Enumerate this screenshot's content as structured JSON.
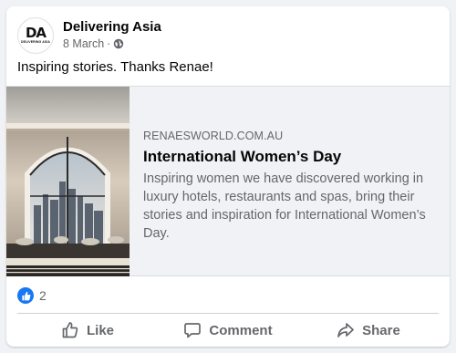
{
  "post": {
    "page_name": "Delivering Asia",
    "date": "8 March",
    "separator": "·",
    "privacy_icon": "globe-icon",
    "text": "Inspiring stories. Thanks Renae!",
    "avatar": {
      "logo_mark": "DA",
      "logo_text": "DELIVERING ASIA"
    }
  },
  "link_preview": {
    "domain": "RENAESWORLD.COM.AU",
    "title": "International Women’s Day",
    "description": "Inspiring women we have discovered working in luxury hotels, restaurants and spas, bring their stories and inspiration for International Women’s Day.",
    "thumbnail_icon": "luxury-hotel-arched-window-image"
  },
  "reactions": {
    "icon": "like-reaction-icon",
    "count": "2"
  },
  "actions": {
    "like": {
      "label": "Like",
      "icon": "thumbs-up-icon"
    },
    "comment": {
      "label": "Comment",
      "icon": "comment-icon"
    },
    "share": {
      "label": "Share",
      "icon": "share-arrow-icon"
    }
  },
  "colors": {
    "accent": "#1877f2",
    "muted_text": "#65676b",
    "background": "#f0f2f5"
  }
}
